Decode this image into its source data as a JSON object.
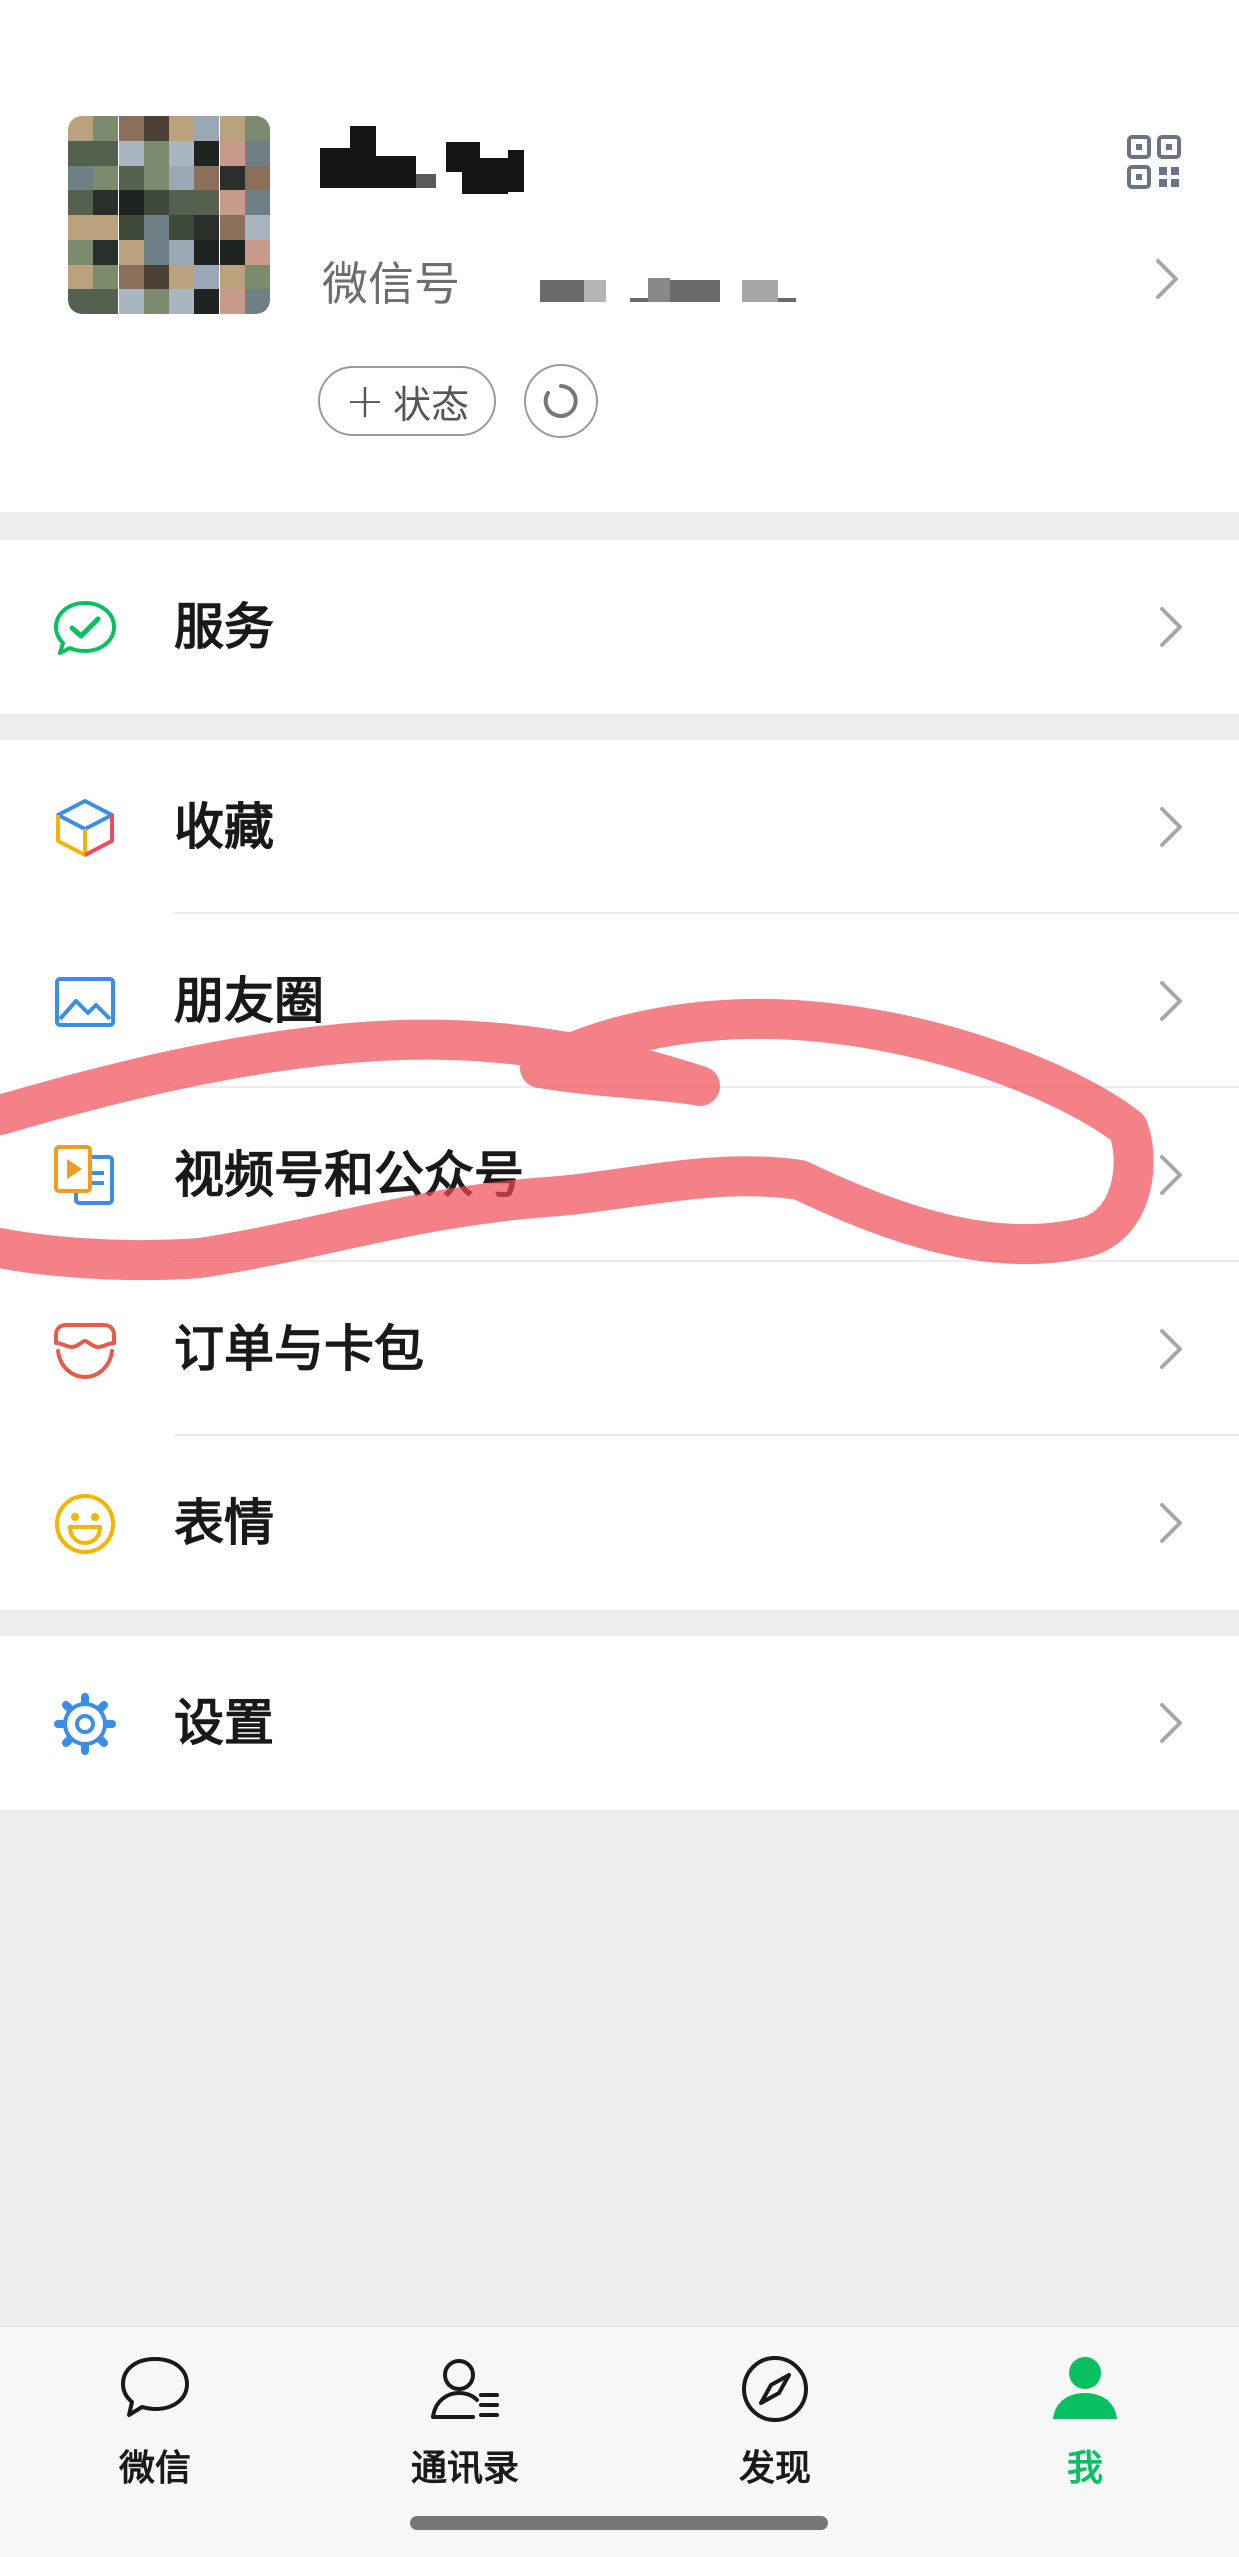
{
  "profile": {
    "wechat_id_label": "微信号",
    "status_button_label": "状态",
    "plus_glyph": "+"
  },
  "menu": {
    "services": "服务",
    "favorites": "收藏",
    "moments": "朋友圈",
    "channels_official": "视频号和公众号",
    "orders_cards": "订单与卡包",
    "stickers": "表情",
    "settings": "设置"
  },
  "tabbar": {
    "chats": "微信",
    "contacts": "通讯录",
    "discover": "发现",
    "me": "我",
    "active_tab": "我"
  },
  "colors": {
    "brand_green": "#07c160",
    "background": "#ededed",
    "annotation_red": "#ef4b56"
  }
}
